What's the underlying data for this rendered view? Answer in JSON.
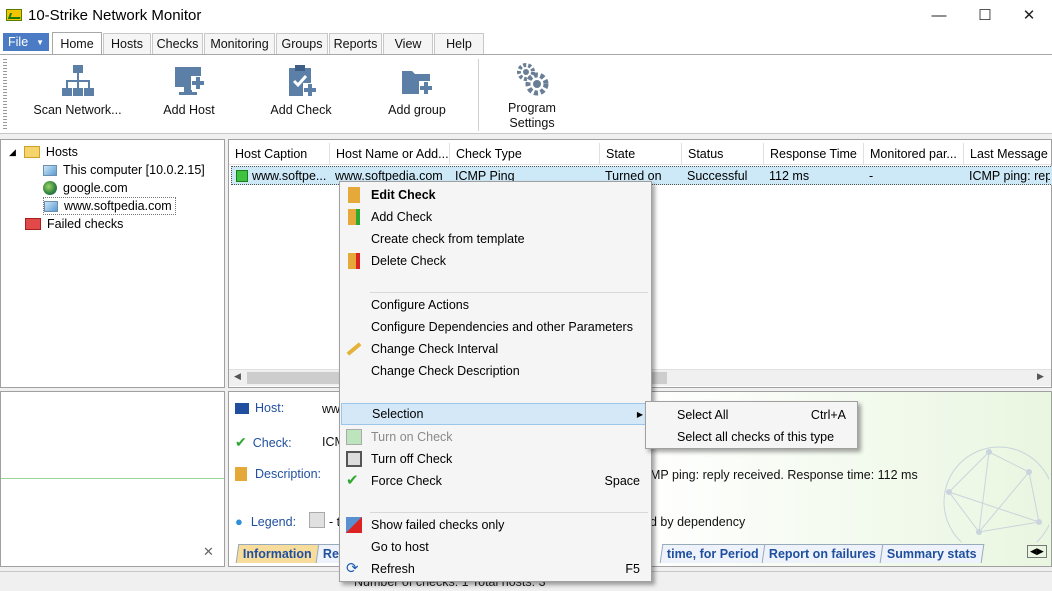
{
  "window": {
    "title": "10-Strike Network Monitor",
    "minimize": "—",
    "maximize": "☐",
    "close": "✕"
  },
  "menu": {
    "file": "File",
    "tabs": [
      "Home",
      "Hosts",
      "Checks",
      "Monitoring",
      "Groups",
      "Reports",
      "View",
      "Help"
    ]
  },
  "ribbon": {
    "buttons": [
      "Scan Network...",
      "Add Host",
      "Add Check",
      "Add group",
      "Program Settings"
    ]
  },
  "tree": {
    "root": "Hosts",
    "items": [
      "This computer [10.0.2.15]",
      "google.com",
      "www.softpedia.com"
    ],
    "failed": "Failed checks"
  },
  "grid": {
    "columns": [
      "Host Caption",
      "Host Name or Add...",
      "Check Type",
      "State",
      "Status",
      "Response Time",
      "Monitored par...",
      "Last Message"
    ],
    "row": [
      "www.softpe...",
      "www.softpedia.com",
      "ICMP Ping",
      "Turned on",
      "Successful",
      "112 ms",
      "-",
      "ICMP ping: repl"
    ]
  },
  "info": {
    "host_label": "Host:",
    "host_value": "ww",
    "check_label": "Check:",
    "check_value": "ICM",
    "description_label": "Description:",
    "description_value": "MP ping: reply received. Response time: 112 ms",
    "legend_label": "Legend:",
    "legend_value": "- t",
    "legend_tail": "d by dependency",
    "tabs": [
      "Information",
      "Res",
      "time, for Period",
      "Report on failures",
      "Summary stats"
    ]
  },
  "status": {
    "text": "Number of checks: 1   Total hosts: 3"
  },
  "context_menu": {
    "items": [
      {
        "label": "Edit Check",
        "shortcut": ""
      },
      {
        "label": "Add Check",
        "shortcut": ""
      },
      {
        "label": "Create check from template",
        "shortcut": ""
      },
      {
        "label": "Delete Check",
        "shortcut": ""
      },
      {
        "label": "Configure Actions",
        "shortcut": ""
      },
      {
        "label": "Configure Dependencies and other Parameters",
        "shortcut": ""
      },
      {
        "label": "Change Check Interval",
        "shortcut": ""
      },
      {
        "label": "Change Check Description",
        "shortcut": ""
      },
      {
        "label": "Selection",
        "shortcut": ""
      },
      {
        "label": "Turn on Check",
        "shortcut": ""
      },
      {
        "label": "Turn off Check",
        "shortcut": ""
      },
      {
        "label": "Force Check",
        "shortcut": "Space"
      },
      {
        "label": "Show failed checks only",
        "shortcut": ""
      },
      {
        "label": "Go to host",
        "shortcut": ""
      },
      {
        "label": "Refresh",
        "shortcut": "F5"
      }
    ]
  },
  "submenu": {
    "items": [
      {
        "label": "Select All",
        "shortcut": "Ctrl+A"
      },
      {
        "label": "Select all checks of this type",
        "shortcut": ""
      }
    ]
  },
  "colors": {
    "accent": "#4a7bc4",
    "selection": "#cde8f7",
    "link": "#1f4f9e"
  }
}
